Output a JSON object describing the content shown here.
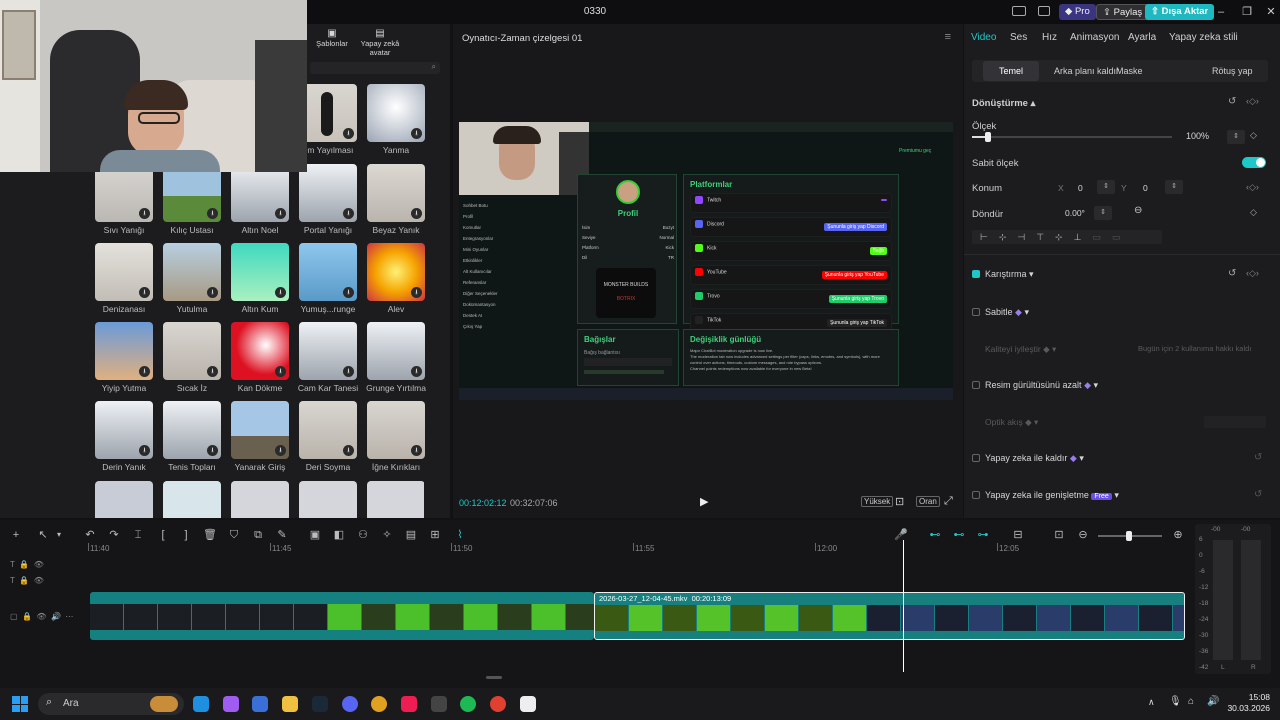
{
  "window": {
    "title": "0330",
    "pro_label": "Pro",
    "share_label": "Paylaş",
    "export_label": "Dışa Aktar"
  },
  "left": {
    "tabs": [
      {
        "label": "Şablonlar"
      },
      {
        "label": "Yapay zekâ avatar"
      }
    ],
    "row0": [
      "um Yayılması",
      "Yanma"
    ],
    "items": [
      "Sıvı Yanığı",
      "Kılıç Ustası",
      "Altın Noel",
      "Portal Yanığı",
      "Beyaz Yanık",
      "Denizanası",
      "Yutulma",
      "Altın Kum",
      "Yumuş...runge",
      "Alev",
      "Yiyip Yutma",
      "Sıcak İz",
      "Kan Dökme",
      "Cam Kar Tanesi",
      "Grunge Yırtılma",
      "Derin Yanık",
      "Tenis Topları",
      "Yanarak Giriş",
      "Deri Soyma",
      "İğne Kırıkları"
    ]
  },
  "player": {
    "title": "Oynatıcı-Zaman çizelgesi 01",
    "current_time": "00:12:02:12",
    "total_time": "00:32:07:06",
    "quality_label": "Yüksek",
    "ratio_label": "Oran",
    "screen": {
      "premium": "Premiumu geç",
      "sidebar": [
        "Sohbet Botu",
        "Profil",
        "Komutlar",
        "Entegrasyonlar",
        "Mini Oyunlar",
        "Etkinlikler",
        "Alt Kullanıcılar",
        "Referanslar",
        "Diğer Seçenekler",
        "Dokümantasyon",
        "Destek AI",
        "Çıkış Yap"
      ],
      "profile_title": "Profil",
      "profile_rows": [
        [
          "İsim",
          "Bozyt"
        ],
        [
          "Seviye",
          "Normal"
        ],
        [
          "Platform",
          "Kick"
        ],
        [
          "Dil",
          "TR"
        ]
      ],
      "logo_text": "MONSTER BUILDS",
      "logo_sub": "BOTRIX",
      "platforms_title": "Platformlar",
      "platforms": [
        {
          "name": "Twitch",
          "action": ""
        },
        {
          "name": "Discord",
          "action": "Şununla giriş yap Discord"
        },
        {
          "name": "Kick",
          "action": "Bağlı"
        },
        {
          "name": "YouTube",
          "action": "Şununla giriş yap YouTube"
        },
        {
          "name": "Trovo",
          "action": "Şununla giriş yap Trovo"
        },
        {
          "name": "TikTok",
          "action": "Şununla giriş yap TikTok"
        }
      ],
      "donations_title": "Bağışlar",
      "donations_sub": "Bağış bağlantısı",
      "changelog_title": "Değişiklik günlüğü",
      "changelog_lines": [
        "Major ChatBot moderation upgrade is now live.",
        "The moderation tab now includes advanced settings per filter (caps, links, emotes, and symbols), with more control over actions, timeouts, custom messages, and role bypass options.",
        "Channel points redemptions now available for everyone in new Beta!"
      ]
    }
  },
  "right": {
    "tabs": [
      "Video",
      "Ses",
      "Hız",
      "Animasyon",
      "Ayarla",
      "Yapay zeka stili"
    ],
    "subtabs": [
      "Temel",
      "Arka planı kaldır",
      "Maske",
      "Rötuş yap"
    ],
    "transform_label": "Dönüştürme",
    "scale_label": "Ölçek",
    "scale_value": "100%",
    "scale_fraction": 0.08,
    "uniform_scale_label": "Sabit ölçek",
    "position_label": "Konum",
    "pos_x_label": "X",
    "pos_x": "0",
    "pos_y_label": "Y",
    "pos_y": "0",
    "rotate_label": "Döndür",
    "rotate_value": "0.00°",
    "blend_label": "Karıştırma",
    "stabilize_label": "Sabitle",
    "quality_label": "Kaliteyi iyileştir",
    "quality_note": "Bugün için 2 kullanıma hakkı kaldı",
    "denoise_label": "Resim gürültüsünü azalt",
    "optical_label": "Optik akış",
    "ai_remove_label": "Yapay zeka ile kaldır",
    "ai_expand_label": "Yapay zeka ile genişletme",
    "free_badge": "Free"
  },
  "timeline": {
    "ruler": [
      "11:40",
      "11:45",
      "11:50",
      "11:55",
      "12:00",
      "12:05"
    ],
    "clip_name": "2026-03-27_12-04-45.mkv",
    "clip_duration": "00:20:13:09",
    "meter_labels": [
      "-00",
      "-00",
      "6",
      "0",
      "-6",
      "-12",
      "-18",
      "-24",
      "-30",
      "-36",
      "-42",
      "L",
      "R"
    ]
  },
  "taskbar": {
    "search_placeholder": "Ara",
    "time": "15:08",
    "date": "30.03.2026"
  },
  "colors": {
    "accent": "#1fc8c8",
    "clip": "#1a8a8a",
    "pro": "#4a3fb8"
  }
}
